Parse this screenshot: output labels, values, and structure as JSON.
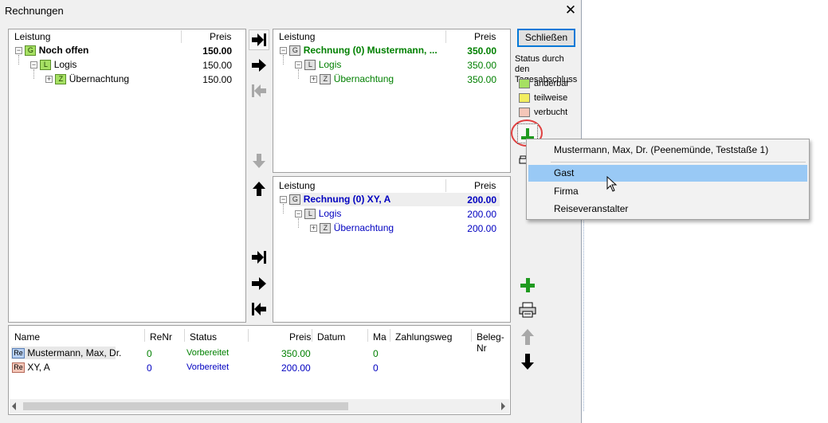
{
  "window": {
    "title": "Rechnungen",
    "close_label": "✕"
  },
  "left_tree": {
    "col_leistung": "Leistung",
    "col_preis": "Preis",
    "rows": [
      {
        "badge": "G",
        "label": "Noch offen",
        "price": "150.00"
      },
      {
        "badge": "L",
        "label": "Logis",
        "price": "150.00"
      },
      {
        "badge": "Z",
        "label": "Übernachtung",
        "price": "150.00"
      }
    ]
  },
  "top_tree": {
    "col_leistung": "Leistung",
    "col_preis": "Preis",
    "color": "#008000",
    "rows": [
      {
        "badge": "G",
        "label": "Rechnung (0) Mustermann, ...",
        "price": "350.00"
      },
      {
        "badge": "L",
        "label": "Logis",
        "price": "350.00"
      },
      {
        "badge": "Z",
        "label": "Übernachtung",
        "price": "350.00"
      }
    ]
  },
  "bottom_tree": {
    "col_leistung": "Leistung",
    "col_preis": "Preis",
    "color": "#0000c0",
    "rows": [
      {
        "badge": "G",
        "label": "Rechnung (0) XY, A",
        "price": "200.00"
      },
      {
        "badge": "L",
        "label": "Logis",
        "price": "200.00"
      },
      {
        "badge": "Z",
        "label": "Übernachtung",
        "price": "200.00"
      }
    ]
  },
  "invoice_table": {
    "columns": {
      "name": "Name",
      "renr": "ReNr",
      "status": "Status",
      "preis": "Preis",
      "datum": "Datum",
      "ma": "Ma",
      "zahlungsweg": "Zahlungsweg",
      "beleg": "Beleg-Nr"
    },
    "rows": [
      {
        "badge": "Re",
        "name": "Mustermann, Max, Dr.",
        "renr": "0",
        "status": "Vorbereitet",
        "preis": "350.00",
        "ma": "0"
      },
      {
        "badge": "Re",
        "name": "XY, A",
        "renr": "0",
        "status": "Vorbereitet",
        "preis": "200.00",
        "ma": "0"
      }
    ]
  },
  "sidebar": {
    "close_button": "Schließen",
    "legend_title_1": "Status durch den",
    "legend_title_2": "Tagesabschluss",
    "legend": [
      {
        "label": "änderbar",
        "color": "#a6e063"
      },
      {
        "label": "teilweise",
        "color": "#f2ee60"
      },
      {
        "label": "verbucht",
        "color": "#f4c6b8"
      }
    ]
  },
  "context_menu": {
    "header": "Mustermann, Max, Dr. (Peenemünde, Teststaße 1)",
    "items": [
      "Gast",
      "Firma",
      "Reiseveranstalter"
    ],
    "highlighted": "Gast"
  },
  "colors": {
    "highlight": "#99c9f5",
    "accent_ring": "#e04040"
  }
}
